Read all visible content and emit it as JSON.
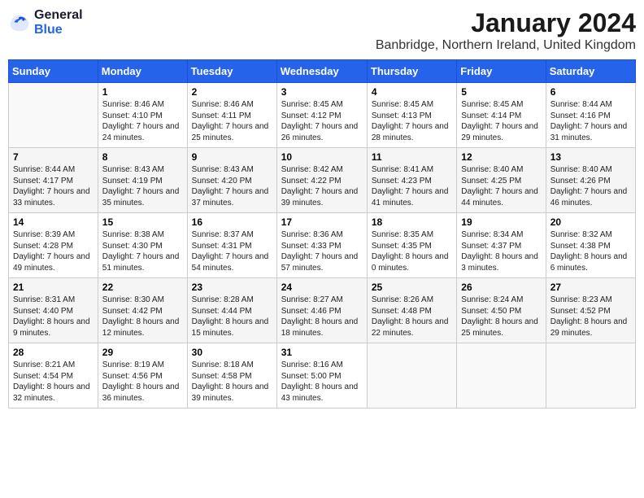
{
  "header": {
    "title": "January 2024",
    "subtitle": "Banbridge, Northern Ireland, United Kingdom",
    "logo_general": "General",
    "logo_blue": "Blue"
  },
  "weekdays": [
    "Sunday",
    "Monday",
    "Tuesday",
    "Wednesday",
    "Thursday",
    "Friday",
    "Saturday"
  ],
  "weeks": [
    [
      {
        "day": "",
        "sunrise": "",
        "sunset": "",
        "daylight": ""
      },
      {
        "day": "1",
        "sunrise": "Sunrise: 8:46 AM",
        "sunset": "Sunset: 4:10 PM",
        "daylight": "Daylight: 7 hours and 24 minutes."
      },
      {
        "day": "2",
        "sunrise": "Sunrise: 8:46 AM",
        "sunset": "Sunset: 4:11 PM",
        "daylight": "Daylight: 7 hours and 25 minutes."
      },
      {
        "day": "3",
        "sunrise": "Sunrise: 8:45 AM",
        "sunset": "Sunset: 4:12 PM",
        "daylight": "Daylight: 7 hours and 26 minutes."
      },
      {
        "day": "4",
        "sunrise": "Sunrise: 8:45 AM",
        "sunset": "Sunset: 4:13 PM",
        "daylight": "Daylight: 7 hours and 28 minutes."
      },
      {
        "day": "5",
        "sunrise": "Sunrise: 8:45 AM",
        "sunset": "Sunset: 4:14 PM",
        "daylight": "Daylight: 7 hours and 29 minutes."
      },
      {
        "day": "6",
        "sunrise": "Sunrise: 8:44 AM",
        "sunset": "Sunset: 4:16 PM",
        "daylight": "Daylight: 7 hours and 31 minutes."
      }
    ],
    [
      {
        "day": "7",
        "sunrise": "Sunrise: 8:44 AM",
        "sunset": "Sunset: 4:17 PM",
        "daylight": "Daylight: 7 hours and 33 minutes."
      },
      {
        "day": "8",
        "sunrise": "Sunrise: 8:43 AM",
        "sunset": "Sunset: 4:19 PM",
        "daylight": "Daylight: 7 hours and 35 minutes."
      },
      {
        "day": "9",
        "sunrise": "Sunrise: 8:43 AM",
        "sunset": "Sunset: 4:20 PM",
        "daylight": "Daylight: 7 hours and 37 minutes."
      },
      {
        "day": "10",
        "sunrise": "Sunrise: 8:42 AM",
        "sunset": "Sunset: 4:22 PM",
        "daylight": "Daylight: 7 hours and 39 minutes."
      },
      {
        "day": "11",
        "sunrise": "Sunrise: 8:41 AM",
        "sunset": "Sunset: 4:23 PM",
        "daylight": "Daylight: 7 hours and 41 minutes."
      },
      {
        "day": "12",
        "sunrise": "Sunrise: 8:40 AM",
        "sunset": "Sunset: 4:25 PM",
        "daylight": "Daylight: 7 hours and 44 minutes."
      },
      {
        "day": "13",
        "sunrise": "Sunrise: 8:40 AM",
        "sunset": "Sunset: 4:26 PM",
        "daylight": "Daylight: 7 hours and 46 minutes."
      }
    ],
    [
      {
        "day": "14",
        "sunrise": "Sunrise: 8:39 AM",
        "sunset": "Sunset: 4:28 PM",
        "daylight": "Daylight: 7 hours and 49 minutes."
      },
      {
        "day": "15",
        "sunrise": "Sunrise: 8:38 AM",
        "sunset": "Sunset: 4:30 PM",
        "daylight": "Daylight: 7 hours and 51 minutes."
      },
      {
        "day": "16",
        "sunrise": "Sunrise: 8:37 AM",
        "sunset": "Sunset: 4:31 PM",
        "daylight": "Daylight: 7 hours and 54 minutes."
      },
      {
        "day": "17",
        "sunrise": "Sunrise: 8:36 AM",
        "sunset": "Sunset: 4:33 PM",
        "daylight": "Daylight: 7 hours and 57 minutes."
      },
      {
        "day": "18",
        "sunrise": "Sunrise: 8:35 AM",
        "sunset": "Sunset: 4:35 PM",
        "daylight": "Daylight: 8 hours and 0 minutes."
      },
      {
        "day": "19",
        "sunrise": "Sunrise: 8:34 AM",
        "sunset": "Sunset: 4:37 PM",
        "daylight": "Daylight: 8 hours and 3 minutes."
      },
      {
        "day": "20",
        "sunrise": "Sunrise: 8:32 AM",
        "sunset": "Sunset: 4:38 PM",
        "daylight": "Daylight: 8 hours and 6 minutes."
      }
    ],
    [
      {
        "day": "21",
        "sunrise": "Sunrise: 8:31 AM",
        "sunset": "Sunset: 4:40 PM",
        "daylight": "Daylight: 8 hours and 9 minutes."
      },
      {
        "day": "22",
        "sunrise": "Sunrise: 8:30 AM",
        "sunset": "Sunset: 4:42 PM",
        "daylight": "Daylight: 8 hours and 12 minutes."
      },
      {
        "day": "23",
        "sunrise": "Sunrise: 8:28 AM",
        "sunset": "Sunset: 4:44 PM",
        "daylight": "Daylight: 8 hours and 15 minutes."
      },
      {
        "day": "24",
        "sunrise": "Sunrise: 8:27 AM",
        "sunset": "Sunset: 4:46 PM",
        "daylight": "Daylight: 8 hours and 18 minutes."
      },
      {
        "day": "25",
        "sunrise": "Sunrise: 8:26 AM",
        "sunset": "Sunset: 4:48 PM",
        "daylight": "Daylight: 8 hours and 22 minutes."
      },
      {
        "day": "26",
        "sunrise": "Sunrise: 8:24 AM",
        "sunset": "Sunset: 4:50 PM",
        "daylight": "Daylight: 8 hours and 25 minutes."
      },
      {
        "day": "27",
        "sunrise": "Sunrise: 8:23 AM",
        "sunset": "Sunset: 4:52 PM",
        "daylight": "Daylight: 8 hours and 29 minutes."
      }
    ],
    [
      {
        "day": "28",
        "sunrise": "Sunrise: 8:21 AM",
        "sunset": "Sunset: 4:54 PM",
        "daylight": "Daylight: 8 hours and 32 minutes."
      },
      {
        "day": "29",
        "sunrise": "Sunrise: 8:19 AM",
        "sunset": "Sunset: 4:56 PM",
        "daylight": "Daylight: 8 hours and 36 minutes."
      },
      {
        "day": "30",
        "sunrise": "Sunrise: 8:18 AM",
        "sunset": "Sunset: 4:58 PM",
        "daylight": "Daylight: 8 hours and 39 minutes."
      },
      {
        "day": "31",
        "sunrise": "Sunrise: 8:16 AM",
        "sunset": "Sunset: 5:00 PM",
        "daylight": "Daylight: 8 hours and 43 minutes."
      },
      {
        "day": "",
        "sunrise": "",
        "sunset": "",
        "daylight": ""
      },
      {
        "day": "",
        "sunrise": "",
        "sunset": "",
        "daylight": ""
      },
      {
        "day": "",
        "sunrise": "",
        "sunset": "",
        "daylight": ""
      }
    ]
  ]
}
